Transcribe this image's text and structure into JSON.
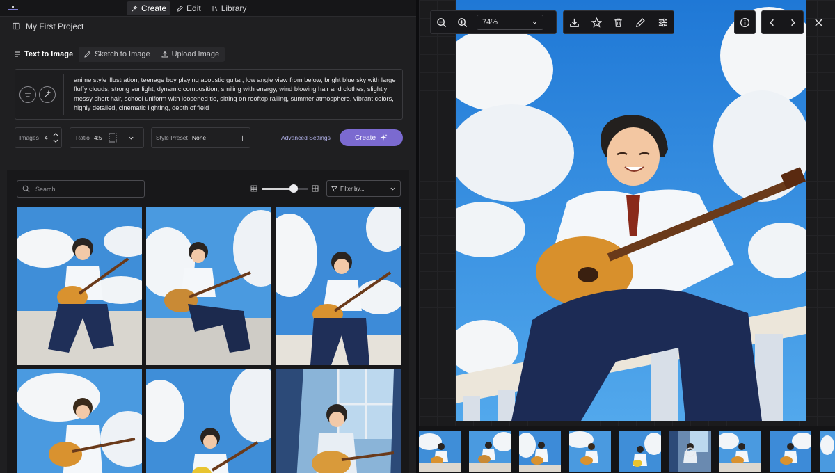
{
  "nav": {
    "tabs": [
      {
        "label": "Create",
        "icon": "sparkle-icon",
        "active": true
      },
      {
        "label": "Edit",
        "icon": "pencil-icon",
        "active": false
      },
      {
        "label": "Library",
        "icon": "books-icon",
        "active": false
      }
    ]
  },
  "project": {
    "title": "My First Project"
  },
  "mode_tabs": [
    {
      "label": "Text to Image",
      "icon": "lines-icon",
      "active": true
    },
    {
      "label": "Sketch to Image",
      "icon": "pencil-icon",
      "active": false
    },
    {
      "label": "Upload Image",
      "icon": "upload-icon",
      "active": false
    }
  ],
  "prompt": {
    "text": "anime style illustration, teenage boy playing acoustic guitar, low angle view from below, bright blue sky with large fluffy clouds, strong sunlight, dynamic composition, smiling with energy, wind blowing hair and clothes, slightly messy short hair, school uniform with loosened tie, sitting on rooftop railing, summer atmosphere, vibrant colors, highly detailed, cinematic lighting, depth of field"
  },
  "controls": {
    "images_label": "Images",
    "images_value": "4",
    "ratio_label": "Ratio",
    "ratio_value": "4:5",
    "style_label": "Style Preset",
    "style_value": "None",
    "advanced_label": "Advanced Settings",
    "create_label": "Create"
  },
  "gallery": {
    "search_placeholder": "Search",
    "filter_label": "Filter by...",
    "size_slider_value": 0.68
  },
  "viewer": {
    "zoom": "74%"
  },
  "colors": {
    "accent": "#7b6ad0",
    "sky": "#3d8fe0",
    "background": "#1f1f21"
  }
}
